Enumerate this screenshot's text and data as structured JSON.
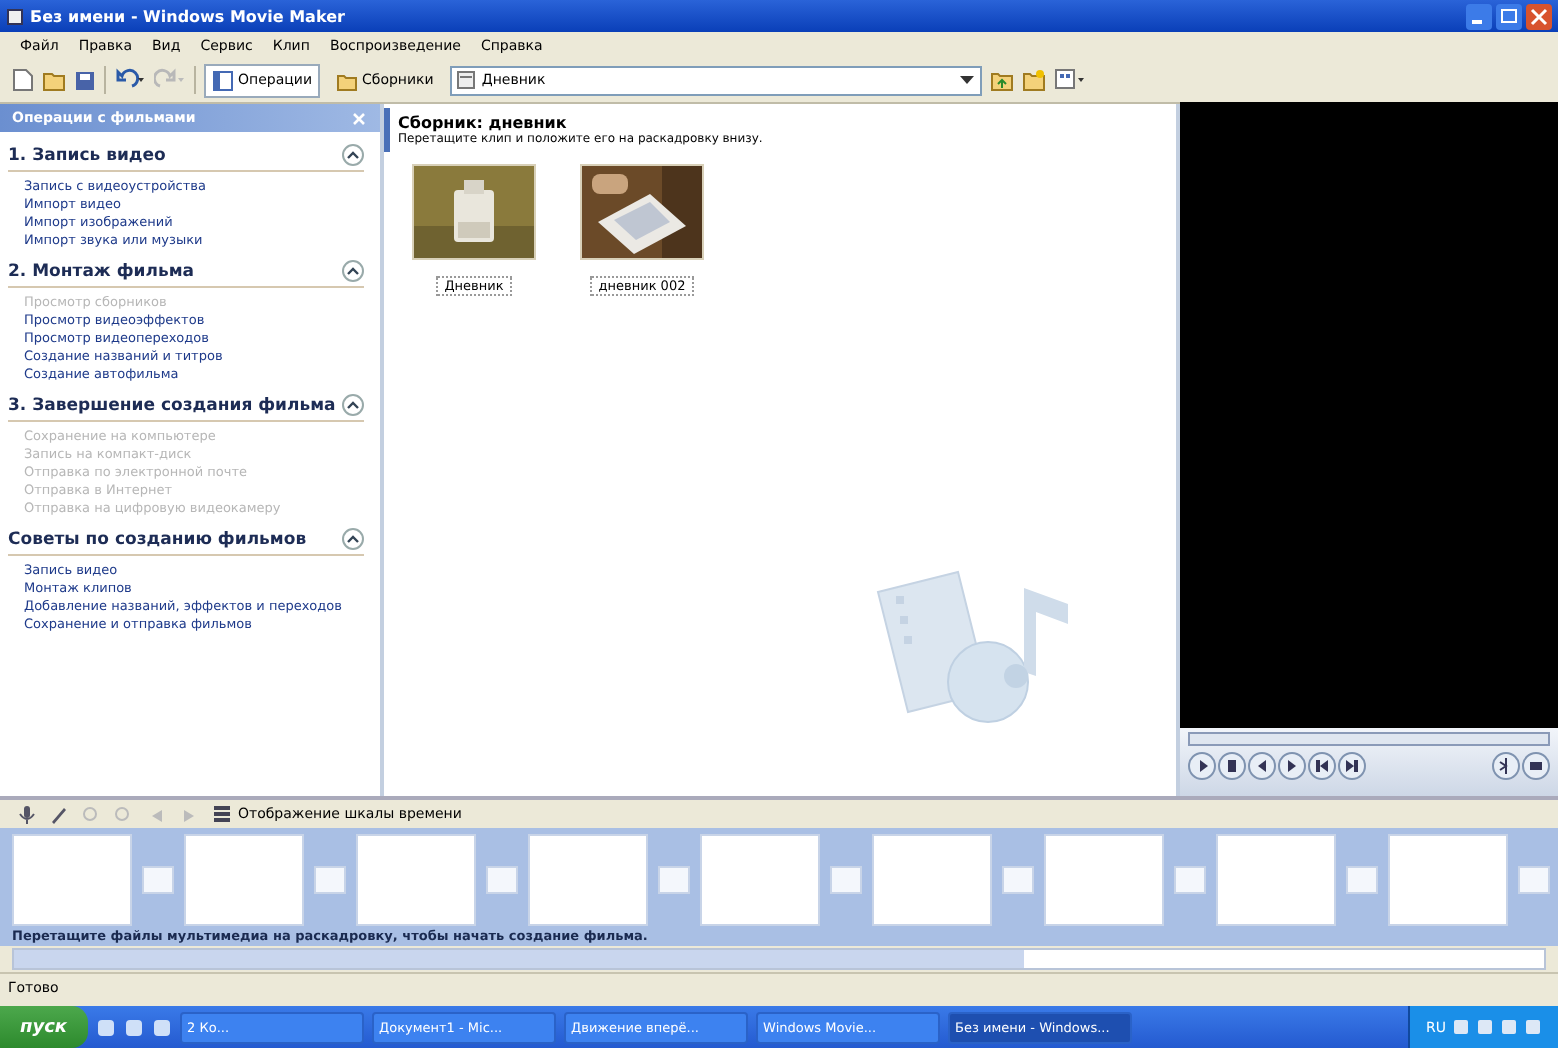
{
  "window": {
    "title": "Без имени - Windows Movie Maker"
  },
  "menu": [
    "Файл",
    "Правка",
    "Вид",
    "Сервис",
    "Клип",
    "Воспроизведение",
    "Справка"
  ],
  "toolbar": {
    "buttons": [
      {
        "label": "Операции",
        "kind": "pane",
        "selected": true
      },
      {
        "label": "Сборники",
        "kind": "folder",
        "selected": false
      }
    ],
    "collection": "Дневник"
  },
  "tasks": {
    "title": "Операции с фильмами",
    "sections": [
      {
        "title": "1. Запись видео",
        "expanded": true,
        "items": [
          {
            "label": "Запись с видеоустройства",
            "disabled": false
          },
          {
            "label": "Импорт видео",
            "disabled": false
          },
          {
            "label": "Импорт изображений",
            "disabled": false
          },
          {
            "label": "Импорт звука или музыки",
            "disabled": false
          }
        ]
      },
      {
        "title": "2. Монтаж фильма",
        "expanded": true,
        "items": [
          {
            "label": "Просмотр сборников",
            "disabled": true
          },
          {
            "label": "Просмотр видеоэффектов",
            "disabled": false
          },
          {
            "label": "Просмотр видеопереходов",
            "disabled": false
          },
          {
            "label": "Создание названий и титров",
            "disabled": false
          },
          {
            "label": "Создание автофильма",
            "disabled": false
          }
        ]
      },
      {
        "title": "3. Завершение создания фильма",
        "expanded": true,
        "items": [
          {
            "label": "Сохранение на компьютере",
            "disabled": true
          },
          {
            "label": "Запись на компакт-диск",
            "disabled": true
          },
          {
            "label": "Отправка по электронной почте",
            "disabled": true
          },
          {
            "label": "Отправка в Интернет",
            "disabled": true
          },
          {
            "label": "Отправка на цифровую видеокамеру",
            "disabled": true
          }
        ]
      },
      {
        "title": "Советы по созданию фильмов",
        "expanded": true,
        "items": [
          {
            "label": "Запись видео",
            "disabled": false
          },
          {
            "label": "Монтаж клипов",
            "disabled": false
          },
          {
            "label": "Добавление названий, эффектов и переходов",
            "disabled": false
          },
          {
            "label": "Сохранение и отправка фильмов",
            "disabled": false
          }
        ]
      }
    ]
  },
  "collection": {
    "title": "Сборник: дневник",
    "hint": "Перетащите клип и положите его на раскадровку внизу.",
    "clips": [
      {
        "label": "Дневник",
        "kind": "picture"
      },
      {
        "label": "дневник 002",
        "kind": "picture"
      }
    ]
  },
  "storyboard": {
    "view_button": "Отображение шкалы времени",
    "hint": "Перетащите файлы мультимедиа на раскадровку, чтобы начать создание фильма."
  },
  "status_bar": "Готово",
  "taskbar": {
    "start": "пуск",
    "items": [
      {
        "label": "2 Ко...",
        "selected": false
      },
      {
        "label": "Документ1 - Mic...",
        "selected": false
      },
      {
        "label": "Движение вперё...",
        "selected": false
      },
      {
        "label": "Windows Movie...",
        "selected": false
      },
      {
        "label": "Без имени - Windows...",
        "selected": true
      }
    ],
    "language": "RU"
  }
}
